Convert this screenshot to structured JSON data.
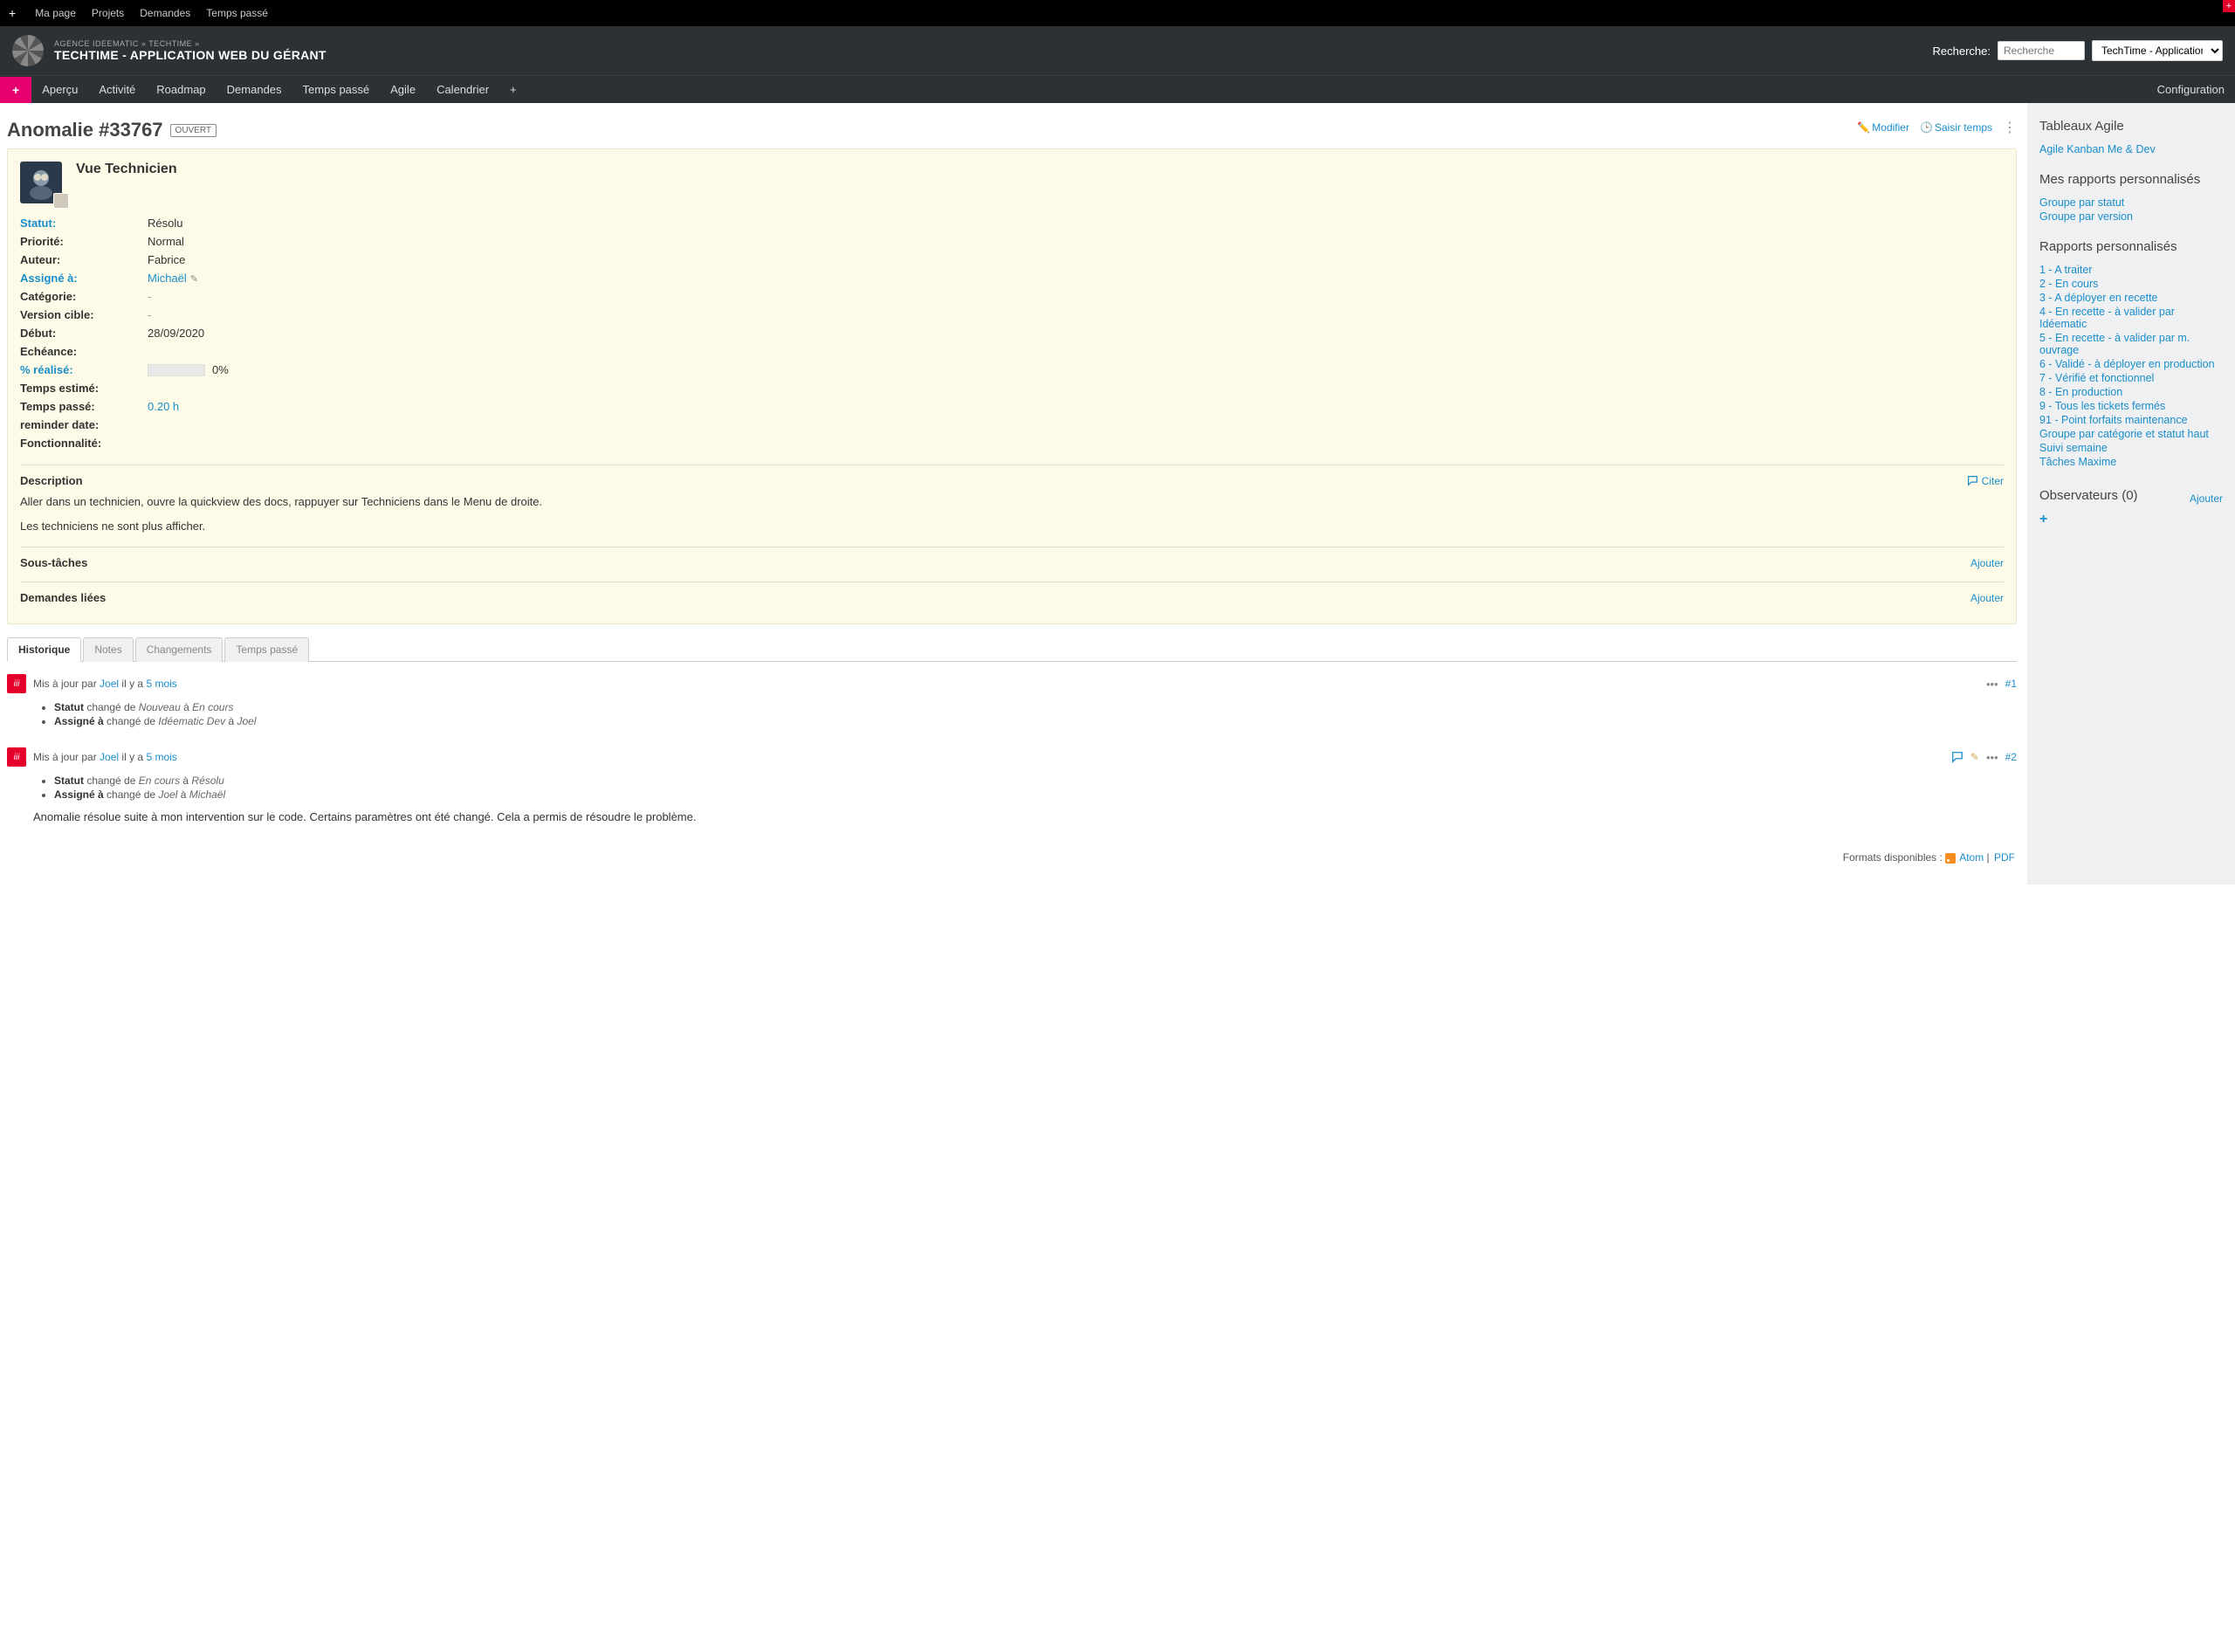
{
  "topbar": {
    "mypage": "Ma page",
    "projects": "Projets",
    "issues": "Demandes",
    "time": "Temps passé"
  },
  "header": {
    "breadcrumb_path": "AGENCE IDEEMATIC » TECHTIME »",
    "breadcrumb_title": "TECHTIME - APPLICATION WEB DU GÉRANT",
    "search_label": "Recherche:",
    "search_placeholder": "Recherche",
    "project_selected": "TechTime - Application web d..."
  },
  "mainnav": {
    "items": [
      "Aperçu",
      "Activité",
      "Roadmap",
      "Demandes",
      "Temps passé",
      "Agile",
      "Calendrier"
    ],
    "config": "Configuration"
  },
  "issue": {
    "title": "Anomalie #33767",
    "status_badge": "OUVERT",
    "modify": "Modifier",
    "logtime": "Saisir temps",
    "subject": "Vue Technicien",
    "attrs": {
      "status_label": "Statut:",
      "status_value": "Résolu",
      "priority_label": "Priorité:",
      "priority_value": "Normal",
      "author_label": "Auteur:",
      "author_value": "Fabrice",
      "assignee_label": "Assigné à:",
      "assignee_value": "Michaël",
      "category_label": "Catégorie:",
      "category_value": "-",
      "version_label": "Version cible:",
      "version_value": "-",
      "start_label": "Début:",
      "start_value": "28/09/2020",
      "due_label": "Echéance:",
      "due_value": "",
      "done_label": "% réalisé:",
      "done_value": "0%",
      "est_label": "Temps estimé:",
      "est_value": "",
      "spent_label": "Temps passé:",
      "spent_value": "0.20 h",
      "reminder_label": "reminder date:",
      "reminder_value": "",
      "feature_label": "Fonctionnalité:",
      "feature_value": ""
    },
    "description_title": "Description",
    "cite": "Citer",
    "desc_p1": "Aller dans un technicien, ouvre la quickview des docs, rappuyer sur Techniciens dans le Menu de droite.",
    "desc_p2": "Les techniciens ne sont plus afficher.",
    "subtasks_title": "Sous-tâches",
    "related_title": "Demandes liées",
    "add": "Ajouter"
  },
  "tabs": {
    "history": "Historique",
    "notes": "Notes",
    "changes": "Changements",
    "time": "Temps passé"
  },
  "journal": {
    "updated_by": "Mis à jour par",
    "ago": "il y a",
    "user": "Joel",
    "when": "5 mois",
    "e1_num": "#1",
    "e1_l1_a": "Statut",
    "e1_l1_b": " changé de ",
    "e1_l1_c": "Nouveau",
    "e1_l1_d": " à ",
    "e1_l1_e": "En cours",
    "e1_l2_a": "Assigné à",
    "e1_l2_b": " changé de ",
    "e1_l2_c": "Idéematic Dev",
    "e1_l2_d": " à ",
    "e1_l2_e": "Joel",
    "e2_num": "#2",
    "e2_l1_a": "Statut",
    "e2_l1_b": " changé de ",
    "e2_l1_c": "En cours",
    "e2_l1_d": " à ",
    "e2_l1_e": "Résolu",
    "e2_l2_a": "Assigné à",
    "e2_l2_b": " changé de ",
    "e2_l2_c": "Joel",
    "e2_l2_d": " à ",
    "e2_l2_e": "Michaël",
    "e2_note": "Anomalie résolue suite à mon intervention sur le code. Certains paramètres ont été changé. Cela a permis de résoudre le problème."
  },
  "sidebar": {
    "agile_title": "Tableaux Agile",
    "agile_link": "Agile Kanban Me & Dev",
    "myreports_title": "Mes rapports personnalisés",
    "myreports": [
      "Groupe par statut",
      "Groupe par version"
    ],
    "reports_title": "Rapports personnalisés",
    "reports": [
      "1 - A traiter",
      "2 - En cours",
      "3 - A déployer en recette",
      "4 - En recette - à valider par Idéematic",
      "5 - En recette - à valider par m. ouvrage",
      "6 - Validé - à déployer en production",
      "7 - Vérifié et fonctionnel",
      "8 - En production",
      "9 - Tous les tickets fermés",
      "91 - Point forfaits maintenance",
      "Groupe par catégorie et statut haut",
      "Suivi semaine",
      "Tâches Maxime"
    ],
    "watchers_title": "Observateurs (0)",
    "watchers_add": "Ajouter"
  },
  "export": {
    "label": "Formats disponibles : ",
    "atom": "Atom",
    "pdf": "PDF"
  }
}
